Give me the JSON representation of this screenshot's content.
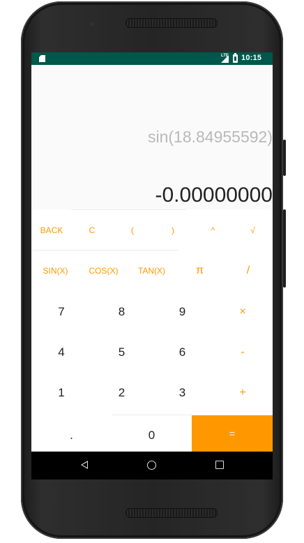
{
  "status_bar": {
    "network": "LTE",
    "time": "10:15"
  },
  "display": {
    "expression": "sin(18.84955592)",
    "result": "-0.00000000"
  },
  "keys": {
    "back": "BACK",
    "clear": "C",
    "open_paren": "(",
    "close_paren": ")",
    "power": "^",
    "sqrt": "√",
    "sin": "SIN(X)",
    "cos": "COS(X)",
    "tan": "TAN(X)",
    "pi": "π",
    "divide": "/",
    "seven": "7",
    "eight": "8",
    "nine": "9",
    "multiply": "×",
    "four": "4",
    "five": "5",
    "six": "6",
    "minus": "-",
    "one": "1",
    "two": "2",
    "three": "3",
    "plus": "+",
    "dot": ".",
    "zero": "0",
    "equals": "="
  },
  "colors": {
    "accent": "#ff9800",
    "status_bar": "#00574b",
    "nav_bar": "#000000"
  },
  "icons": {
    "nav_back": "back-triangle-icon",
    "nav_home": "home-circle-icon",
    "nav_recent": "recent-apps-square-icon"
  }
}
